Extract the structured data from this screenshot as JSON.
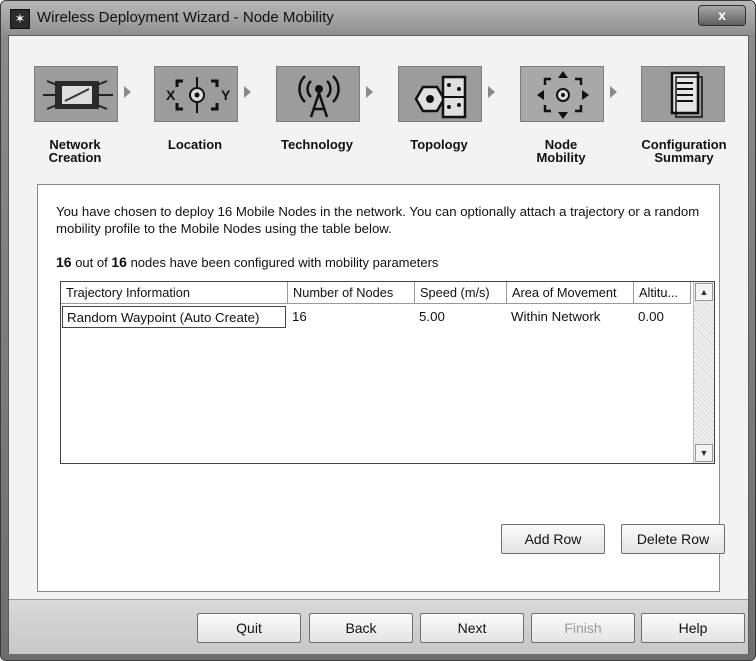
{
  "window": {
    "title": "Wireless Deployment Wizard - Node Mobility",
    "close_glyph": "x",
    "app_glyph": "✶"
  },
  "steps": [
    {
      "label": "Network\nCreation",
      "icon": "network-creation-icon"
    },
    {
      "label": "Location",
      "icon": "location-crosshair-icon"
    },
    {
      "label": "Technology",
      "icon": "antenna-icon"
    },
    {
      "label": "Topology",
      "icon": "topology-icon"
    },
    {
      "label": "Node\nMobility",
      "icon": "node-mobility-icon"
    },
    {
      "label": "Configuration\nSummary",
      "icon": "document-icon"
    }
  ],
  "intro_text": "You have chosen to deploy 16 Mobile Nodes in the network. You can optionally attach a trajectory or a random mobility profile to the Mobile Nodes using the table below.",
  "count": {
    "configured": "16",
    "out_of": "out of",
    "total": "16",
    "suffix": "nodes have been configured with mobility parameters"
  },
  "table": {
    "columns": [
      "Trajectory Information",
      "Number of Nodes",
      "Speed (m/s)",
      "Area of Movement",
      "Altitu..."
    ],
    "rows": [
      [
        "Random Waypoint (Auto Create)",
        "16",
        "5.00",
        "Within Network",
        "0.00"
      ]
    ]
  },
  "buttons": {
    "add_row": "Add Row",
    "delete_row": "Delete Row",
    "quit": "Quit",
    "back": "Back",
    "next": "Next",
    "finish": "Finish",
    "help": "Help"
  }
}
